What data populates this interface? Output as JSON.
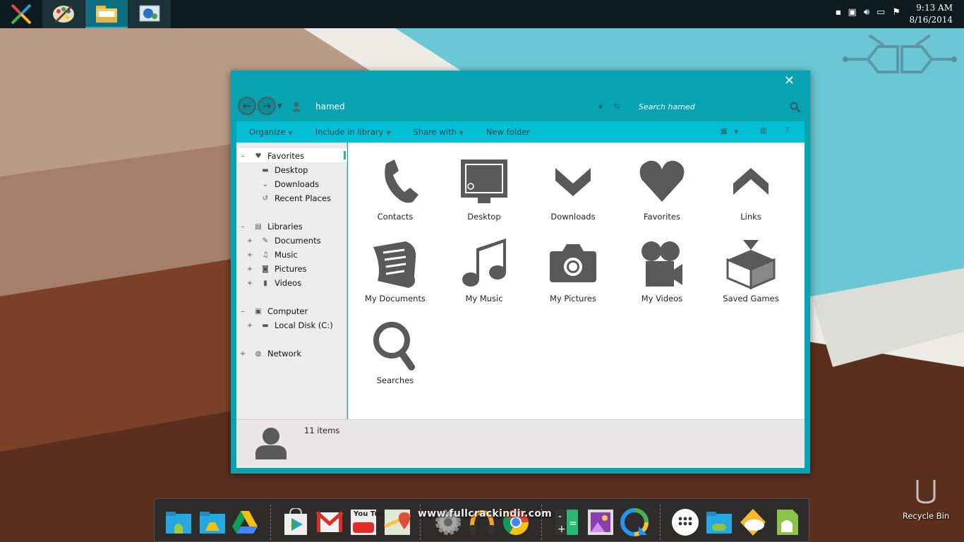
{
  "taskbar": {
    "apps": [
      "start-logo",
      "paint-app",
      "file-explorer",
      "network-app"
    ],
    "active_app": "file-explorer",
    "clock_time": "9:13 AM",
    "clock_date": "8/16/2014"
  },
  "window": {
    "address": "hamed",
    "search_placeholder": "Search hamed",
    "close_glyph": "✕",
    "commands": {
      "organize": "Organize",
      "include": "Include in library",
      "share": "Share with",
      "new_folder": "New folder"
    },
    "nav": {
      "favorites": "Favorites",
      "desktop": "Desktop",
      "downloads": "Downloads",
      "recent": "Recent Places",
      "libraries": "Libraries",
      "documents": "Documents",
      "music": "Music",
      "pictures": "Pictures",
      "videos": "Videos",
      "computer": "Computer",
      "local_disk": "Local Disk (C:)",
      "network": "Network"
    },
    "items": [
      {
        "label": "Contacts",
        "icon": "phone-icon"
      },
      {
        "label": "Desktop",
        "icon": "monitor-icon"
      },
      {
        "label": "Downloads",
        "icon": "chevron-down-icon"
      },
      {
        "label": "Favorites",
        "icon": "heart-icon"
      },
      {
        "label": "Links",
        "icon": "chevron-up-icon"
      },
      {
        "label": "My Documents",
        "icon": "document-icon"
      },
      {
        "label": "My Music",
        "icon": "music-note-icon"
      },
      {
        "label": "My Pictures",
        "icon": "camera-icon"
      },
      {
        "label": "My Videos",
        "icon": "video-camera-icon"
      },
      {
        "label": "Saved Games",
        "icon": "box-icon"
      },
      {
        "label": "Searches",
        "icon": "magnifier-icon"
      }
    ],
    "status": "11 items"
  },
  "dock": {
    "icons": [
      "android-folder",
      "drive-folder",
      "google-drive",
      "play-store",
      "gmail",
      "youtube",
      "maps",
      "settings",
      "headphones",
      "chrome",
      "calculator",
      "gallery",
      "quickoffice",
      "app-drawer",
      "games-folder",
      "weather",
      "android-files"
    ],
    "youtube_text": "You Tube"
  },
  "watermark": "www.fullcrackindir.com",
  "desktop": {
    "recycle_bin": "Recycle Bin"
  },
  "colors": {
    "window_accent": "#07a3b2",
    "command_bar": "#04bed5",
    "taskbar": "#0d1a1e",
    "icon_gray": "#595959"
  }
}
